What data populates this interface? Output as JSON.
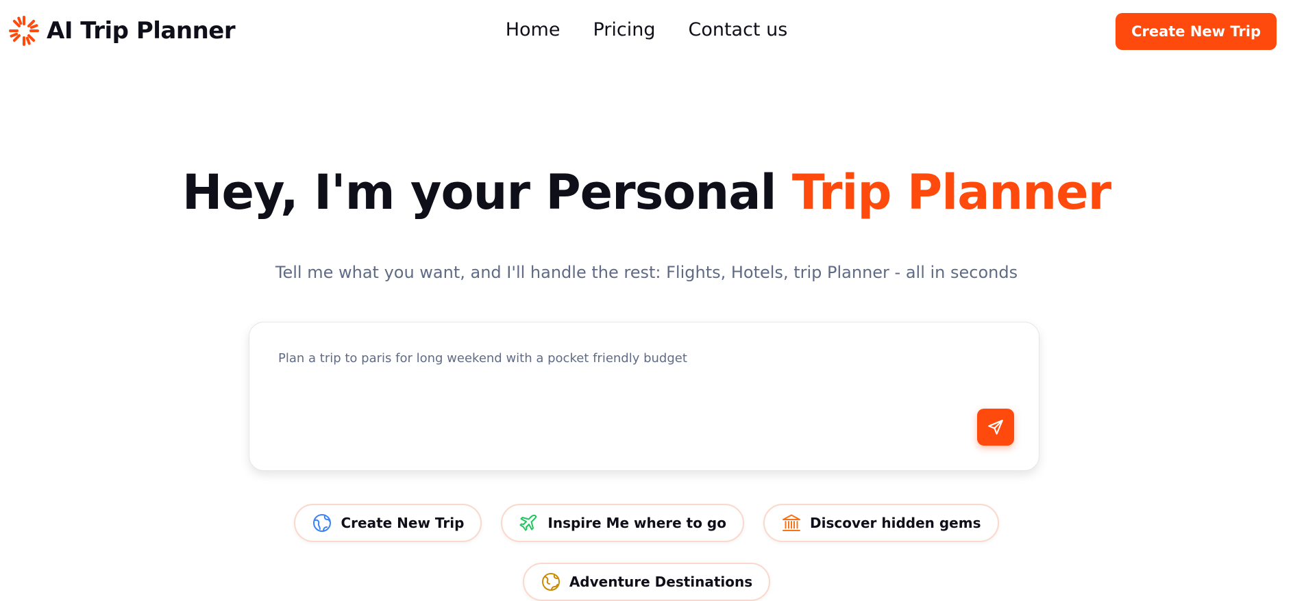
{
  "brand": {
    "name": "AI Trip Planner",
    "accent_color": "#ff4a0d",
    "logo_icon": "sunburst-icon"
  },
  "nav": {
    "items": [
      "Home",
      "Pricing",
      "Contact us"
    ]
  },
  "header": {
    "cta_label": "Create New Trip"
  },
  "hero": {
    "title_prefix": "Hey, I'm your Personal",
    "title_accent": "Trip Planner",
    "subtitle": "Tell me what you want, and I'll handle the rest: Flights, Hotels, trip Planner - all in seconds"
  },
  "prompt": {
    "value": "Plan a trip to paris for long weekend with a pocket friendly budget",
    "send_icon": "send-icon"
  },
  "chips": [
    {
      "label": "Create New Trip",
      "icon": "globe-icon",
      "icon_color": "#3b82f6"
    },
    {
      "label": "Inspire Me where to go",
      "icon": "plane-icon",
      "icon_color": "#22c55e"
    },
    {
      "label": "Discover hidden gems",
      "icon": "landmark-icon",
      "icon_color": "#f97316"
    },
    {
      "label": "Adventure Destinations",
      "icon": "compass-globe-icon",
      "icon_color": "#ca8a04"
    }
  ]
}
